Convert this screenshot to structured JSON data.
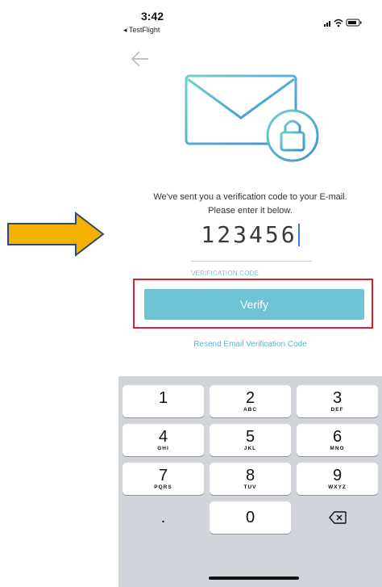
{
  "status_bar": {
    "time": "3:42",
    "back_app": "◂ TestFlight"
  },
  "header": {
    "back_icon": "arrow-left-icon"
  },
  "illustration": {
    "icon": "envelope-lock-icon"
  },
  "message": {
    "line1": "We've sent you a verification code to your E-mail.",
    "line2": "Please enter it below."
  },
  "code_field": {
    "value": "123456",
    "label": "VERIFICATION CODE"
  },
  "verify_button": {
    "label": "Verify"
  },
  "resend_link": {
    "label": "Resend Email Verification Code"
  },
  "keyboard": {
    "keys": [
      {
        "num": "1",
        "letters": ""
      },
      {
        "num": "2",
        "letters": "ABC"
      },
      {
        "num": "3",
        "letters": "DEF"
      },
      {
        "num": "4",
        "letters": "GHI"
      },
      {
        "num": "5",
        "letters": "JKL"
      },
      {
        "num": "6",
        "letters": "MNO"
      },
      {
        "num": "7",
        "letters": "PQRS"
      },
      {
        "num": "8",
        "letters": "TUV"
      },
      {
        "num": "9",
        "letters": "WXYZ"
      },
      {
        "num": ".",
        "letters": ""
      },
      {
        "num": "0",
        "letters": ""
      }
    ],
    "delete_icon": "backspace-icon"
  },
  "colors": {
    "accent": "#6ec3d4",
    "highlight": "#d9202c",
    "arrow_fill": "#f5b301",
    "arrow_stroke": "#2f4a7a"
  }
}
